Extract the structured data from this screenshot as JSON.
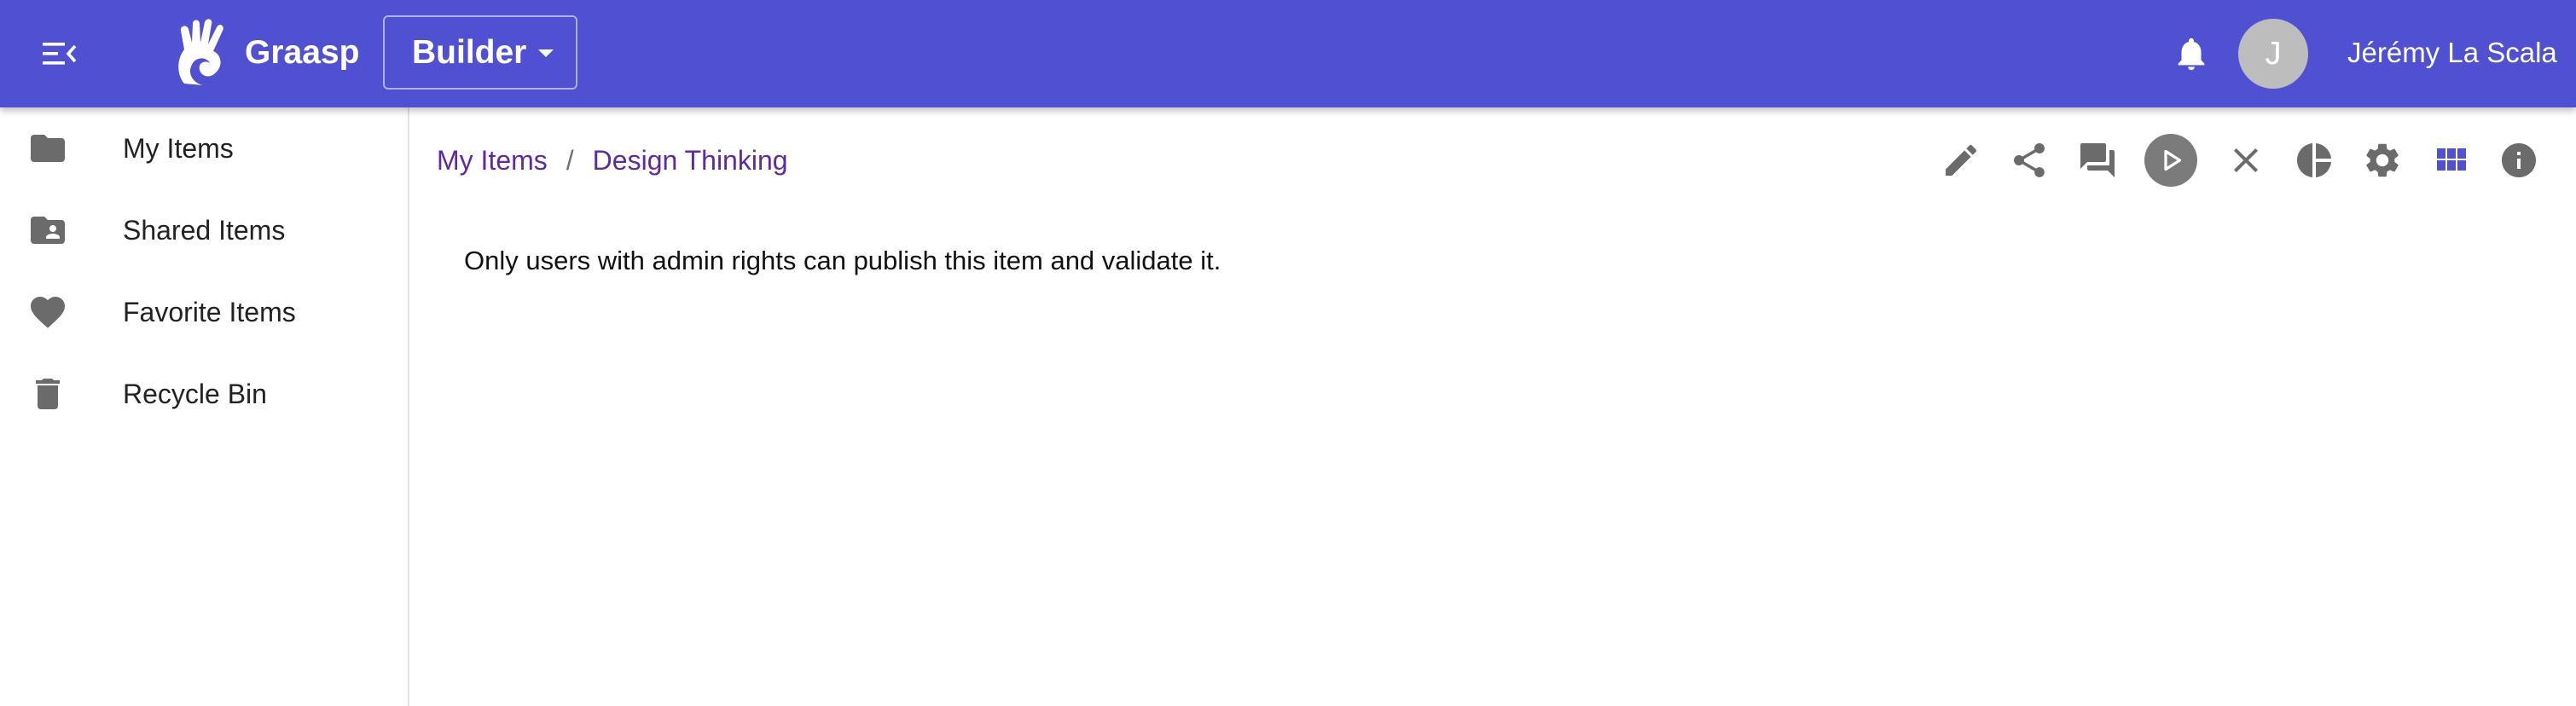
{
  "header": {
    "brand": "Graasp",
    "app_selector": "Builder",
    "avatar_initial": "J",
    "user_name": "Jérémy La Scala",
    "bar_color": "#5050d2"
  },
  "sidebar": {
    "items": [
      {
        "label": "My Items",
        "icon": "folder-icon"
      },
      {
        "label": "Shared Items",
        "icon": "shared-folder-icon"
      },
      {
        "label": "Favorite Items",
        "icon": "heart-icon"
      },
      {
        "label": "Recycle Bin",
        "icon": "trash-icon"
      }
    ]
  },
  "breadcrumb": {
    "root": "My Items",
    "separator": "/",
    "current": "Design Thinking",
    "link_color": "#5d2a9f"
  },
  "toolbar": {
    "icons": [
      "edit-icon",
      "share-icon",
      "chat-icon",
      "play-icon",
      "close-icon",
      "analytics-icon",
      "settings-icon",
      "grid-view-icon",
      "info-icon"
    ],
    "icon_color": "#6b6b6b",
    "active_color": "#5050d2"
  },
  "main": {
    "message": "Only users with admin rights can publish this item and validate it."
  }
}
